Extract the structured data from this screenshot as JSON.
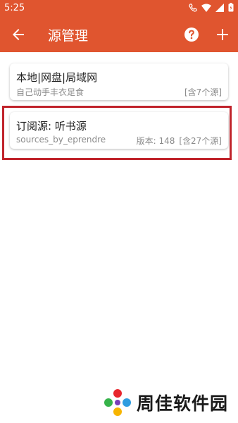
{
  "status_bar": {
    "time": "5:25"
  },
  "app_bar": {
    "title": "源管理"
  },
  "sources": [
    {
      "name": "本地|网盘|局域网",
      "description": "自己动手丰衣足食",
      "version": "",
      "count": "[含7个源]"
    },
    {
      "name": "订阅源: 听书源",
      "description": "sources_by_eprendre",
      "version": "版本: 148",
      "count": "[含27个源]"
    }
  ],
  "watermark": {
    "text": "周佳软件园"
  },
  "colors": {
    "accent": "#e0552f",
    "highlight": "#c0232b"
  }
}
